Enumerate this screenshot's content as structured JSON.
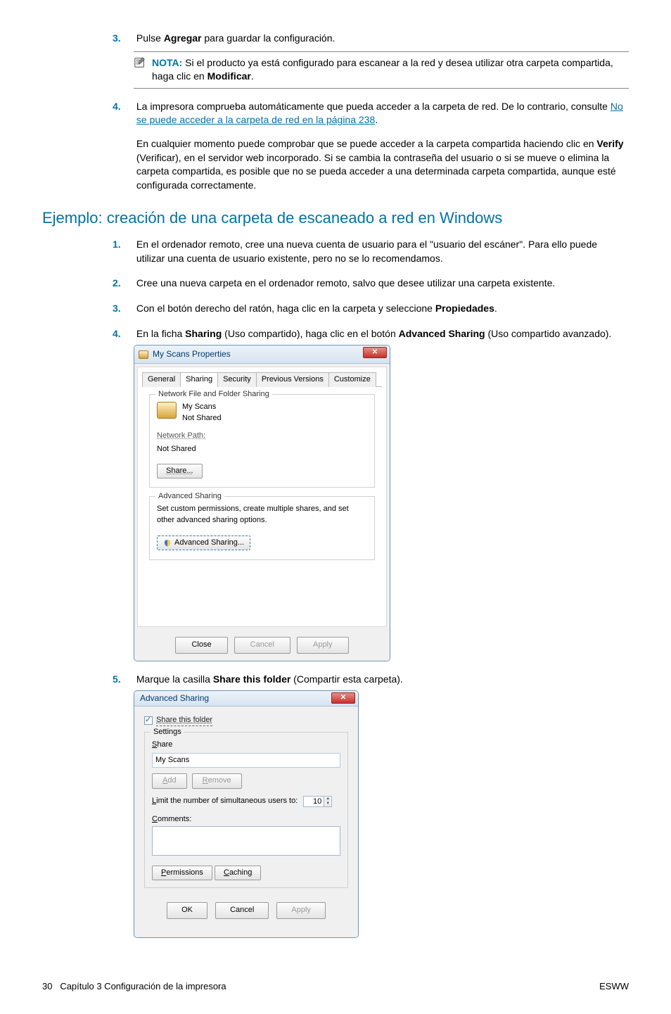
{
  "step3": {
    "num": "3.",
    "pre": "Pulse ",
    "bold1": "Agregar",
    "post": " para guardar la configuración."
  },
  "note": {
    "label": "NOTA:",
    "text1": "   Si el producto ya está configurado para escanear a la red y desea utilizar otra carpeta compartida, haga clic en ",
    "bold": "Modificar",
    "post": "."
  },
  "step4": {
    "num": "4.",
    "line1": "La impresora comprueba automáticamente que pueda acceder a la carpeta de red. De lo contrario, consulte ",
    "link": "No se puede acceder a la carpeta de red en la página 238",
    "after": ".",
    "para2a": "En cualquier momento puede comprobar que se puede acceder a la carpeta compartida haciendo clic en ",
    "boldVerify": "Verify",
    "para2b": " (Verificar), en el servidor web incorporado. Si se cambia la contraseña del usuario o si se mueve o elimina la carpeta compartida, es posible que no se pueda acceder a una determinada carpeta compartida, aunque esté configurada correctamente."
  },
  "heading": "Ejemplo: creación de una carpeta de escaneado a red en Windows",
  "s1": {
    "num": "1.",
    "text": "En el ordenador remoto, cree una nueva cuenta de usuario para el \"usuario del escáner\". Para ello puede utilizar una cuenta de usuario existente, pero no se lo recomendamos."
  },
  "s2": {
    "num": "2.",
    "text": "Cree una nueva carpeta en el ordenador remoto, salvo que desee utilizar una carpeta existente."
  },
  "s3": {
    "num": "3.",
    "pre": "Con el botón derecho del ratón, haga clic en la carpeta y seleccione ",
    "bold": "Propiedades",
    "post": "."
  },
  "s4": {
    "num": "4.",
    "pre": "En la ficha ",
    "b1": "Sharing",
    "mid1": " (Uso compartido), haga clic en el botón ",
    "b2": "Advanced Sharing",
    "post": " (Uso compartido avanzado)."
  },
  "dlg1": {
    "title": "My Scans Properties",
    "tabs": {
      "general": "General",
      "sharing": "Sharing",
      "security": "Security",
      "prev": "Previous Versions",
      "customize": "Customize"
    },
    "fs1": {
      "legend": "Network File and Folder Sharing",
      "name": "My Scans",
      "shared": "Not Shared",
      "netpath_label": "Network Path:",
      "netpath_val": "Not Shared",
      "share_btn": "Share..."
    },
    "fs2": {
      "legend": "Advanced Sharing",
      "desc": "Set custom permissions, create multiple shares, and set other advanced sharing options.",
      "btn": "Advanced Sharing..."
    },
    "footer": {
      "close": "Close",
      "cancel": "Cancel",
      "apply": "Apply"
    }
  },
  "s5": {
    "num": "5.",
    "pre": "Marque la casilla ",
    "bold": "Share this folder",
    "post": " (Compartir esta carpeta)."
  },
  "dlg2": {
    "title": "Advanced Sharing",
    "chk_label": "Share this folder",
    "settings_legend": "Settings",
    "share_label": "Share",
    "share_val": "My Scans",
    "add": "Add",
    "remove": "Remove",
    "limit_label": "Limit the number of simultaneous users to:",
    "limit_val": "10",
    "comments": "Comments:",
    "perm": "Permissions",
    "cache": "Caching",
    "ok": "OK",
    "cancel": "Cancel",
    "apply": "Apply"
  },
  "footer": {
    "page": "30",
    "chapter": "Capítulo 3   Configuración de la impresora",
    "right": "ESWW"
  }
}
